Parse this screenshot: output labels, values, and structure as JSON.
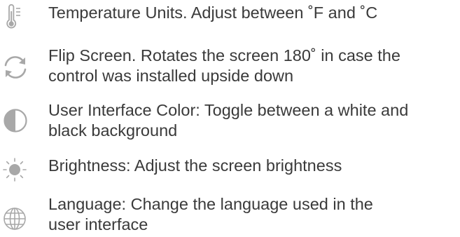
{
  "settings": [
    {
      "icon": "thermometer-icon",
      "lines": [
        "Temperature Units. Adjust between ˚F and ˚C"
      ]
    },
    {
      "icon": "flip-rotate-icon",
      "lines": [
        "Flip Screen. Rotates the screen 180˚ in case the",
        "control was installed upside down"
      ]
    },
    {
      "icon": "contrast-icon",
      "lines": [
        "User Interface Color: Toggle between a white and",
        "black background"
      ]
    },
    {
      "icon": "brightness-sun-icon",
      "lines": [
        "Brightness: Adjust the screen brightness"
      ]
    },
    {
      "icon": "globe-icon",
      "lines": [
        "Language: Change the language used in the",
        "user interface"
      ]
    }
  ],
  "colors": {
    "icon": "#a8a8a8",
    "text": "#3a3a3a",
    "background": "#ffffff"
  }
}
